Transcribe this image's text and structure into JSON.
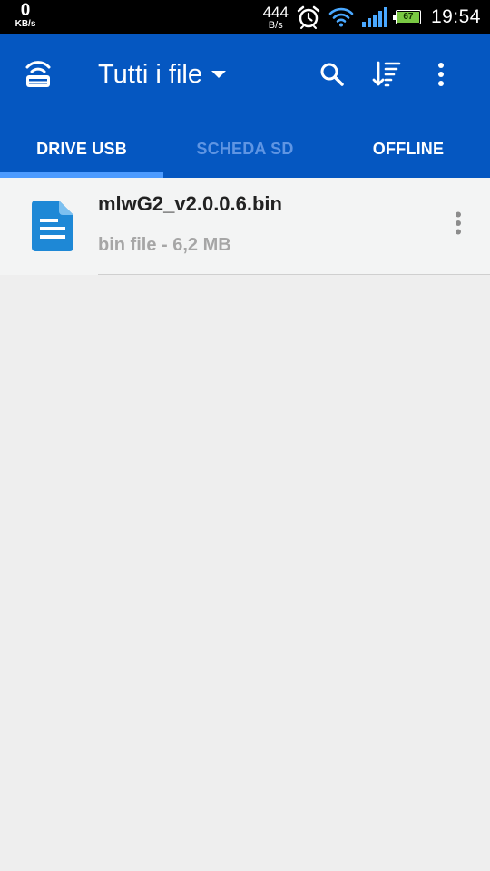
{
  "status_bar": {
    "left_rate": "0",
    "left_unit": "KB/s",
    "right_rate": "444",
    "right_unit": "B/s",
    "battery_level": "67",
    "time": "19:54",
    "icons": [
      "alarm-icon",
      "wifi-icon",
      "signal-icon",
      "battery-icon"
    ]
  },
  "app_bar": {
    "title": "Tutti i file",
    "actions": [
      "search-icon",
      "sort-icon",
      "more-vert-icon"
    ],
    "accent_color": "#0557c1"
  },
  "tabs": [
    {
      "label": "DRIVE USB",
      "selected": true
    },
    {
      "label": "SCHEDA SD",
      "selected": false
    },
    {
      "label": "OFFLINE",
      "selected": false
    }
  ],
  "files": [
    {
      "name": "mlwG2_v2.0.0.6.bin",
      "meta": "bin file - 6,2 MB",
      "icon": "document-icon",
      "icon_color": "#1e88d6"
    }
  ]
}
